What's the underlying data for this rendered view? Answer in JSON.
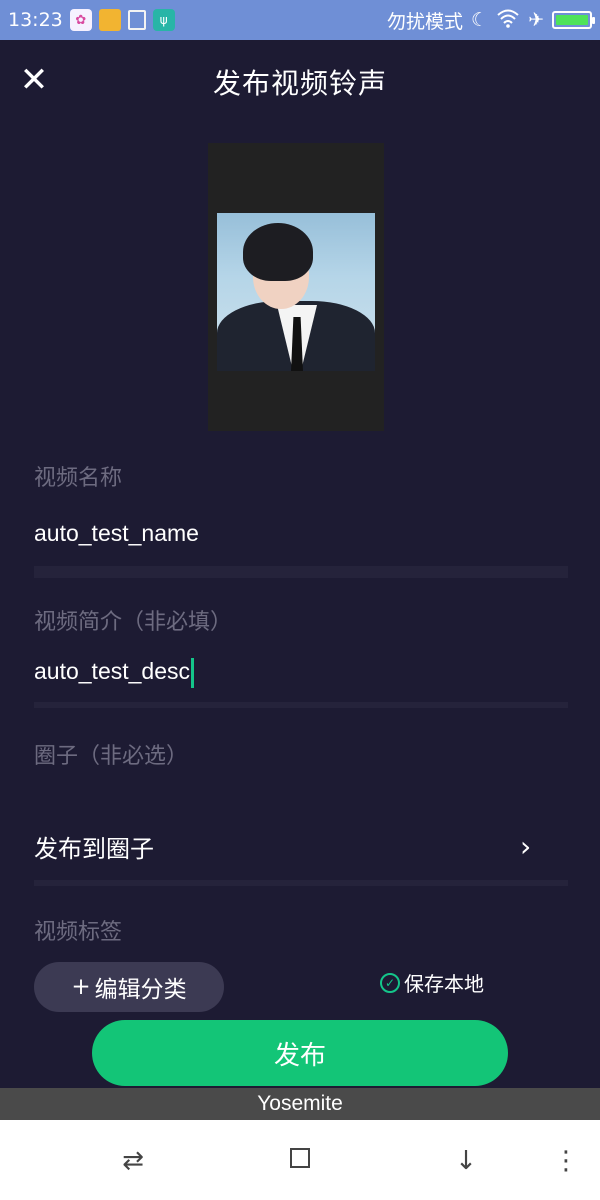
{
  "status_bar": {
    "time": "13:23",
    "dnd_label": "勿扰模式",
    "battery_level": 1.0,
    "icons": [
      "app-icon",
      "folder-icon",
      "cleaner-icon",
      "usb-icon",
      "moon-icon",
      "wifi-icon",
      "airplane-icon",
      "battery-icon"
    ]
  },
  "header": {
    "title": "发布视频铃声",
    "close_icon": "close-icon"
  },
  "form": {
    "name_label": "视频名称",
    "name_value": "auto_test_name",
    "desc_label": "视频简介（非必填）",
    "desc_value": "auto_test_desc",
    "circle_label": "圈子（非必选）",
    "circle_action": "发布到圈子",
    "tags_label": "视频标签",
    "edit_category": "编辑分类",
    "save_local": "保存本地"
  },
  "publish_label": "发布",
  "toast": "Yosemite",
  "colors": {
    "background": "#1d1b33",
    "accent": "#13c577",
    "status_bar": "#6f8fd6"
  }
}
